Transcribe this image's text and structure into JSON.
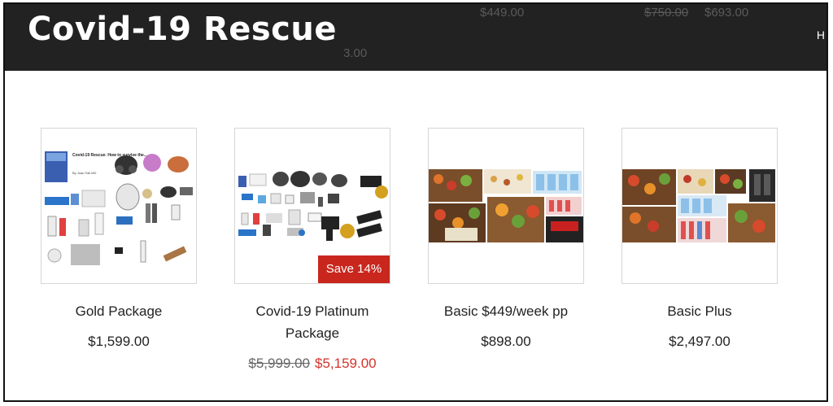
{
  "header": {
    "site_title": "Covid-19 Rescue",
    "nav_fragment": "H",
    "ghost_price_a": "$449.00",
    "ghost_price_b_old": "$750.00",
    "ghost_price_b_new": "$693.00",
    "ghost_price_c": "3.00"
  },
  "products": [
    {
      "title": "Gold Package",
      "price": "$1,599.00",
      "image_cover_title": "Covid-19 Rescue: How to survive the...",
      "image_cover_author": "By Joan Fall MD"
    },
    {
      "title": "Covid-19 Platinum Package",
      "price_old": "$5,999.00",
      "price_new": "$5,159.00",
      "badge": "Save 14%"
    },
    {
      "title": "Basic $449/week pp",
      "price": "$898.00"
    },
    {
      "title": "Basic Plus",
      "price": "$2,497.00"
    }
  ],
  "colors": {
    "header_bg": "#222222",
    "sale_badge": "#c9271d",
    "sale_price": "#d3322b"
  }
}
